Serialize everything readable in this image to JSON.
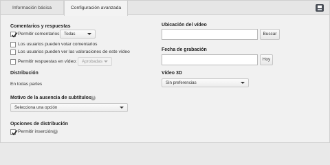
{
  "tabs": [
    {
      "label": "Información básica"
    },
    {
      "label": "Configuración avanzada"
    }
  ],
  "comments": {
    "title": "Comentarios y respuestas",
    "allow_comments_label": "Permitir comentarios",
    "allow_comments_checked": true,
    "comments_select_value": "Todas",
    "vote_label": "Los usuarios pueden votar comentarios",
    "vote_checked": false,
    "ratings_label": "Los usuarios pueden ver las valoraciones de este vídeo",
    "ratings_checked": false,
    "video_replies_label": "Permitir respuestas en vídeo:",
    "video_replies_checked": false,
    "video_replies_select_value": "Aprobadas"
  },
  "distribution": {
    "title": "Distribución",
    "value": "En todas partes"
  },
  "subtitles": {
    "title": "Motivo de la ausencia de subtítulos",
    "help_symbol": "?",
    "select_value": "Selecciona una opción"
  },
  "distribution_options": {
    "title": "Opciones de distribución",
    "embed_label": "Permitir inserción",
    "embed_checked": true,
    "help_symbol": "?"
  },
  "location": {
    "title": "Ubicación del vídeo",
    "input_value": "",
    "button_label": "Buscar"
  },
  "recording_date": {
    "title": "Fecha de grabación",
    "input_value": "",
    "button_label": "Hoy"
  },
  "video3d": {
    "title": "Vídeo 3D",
    "select_value": "Sin preferencias"
  }
}
